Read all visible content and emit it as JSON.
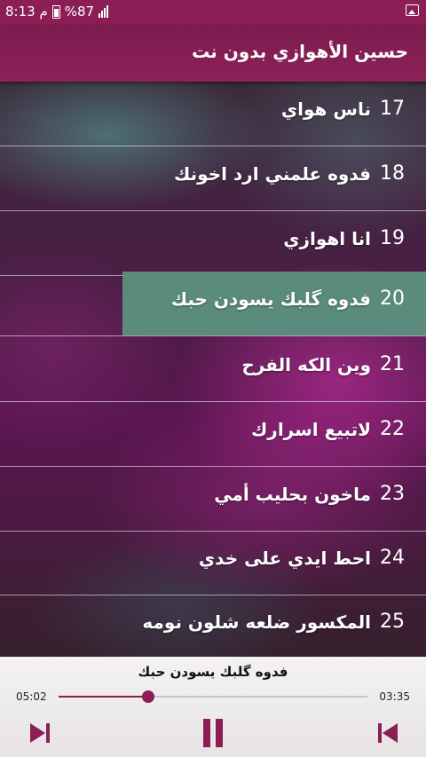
{
  "status_bar": {
    "time": "8:13 م",
    "battery": "%87",
    "icons": [
      "battery-icon",
      "signal-icon",
      "image-notification-icon"
    ]
  },
  "header": {
    "title": "حسين الأهوازي بدون نت"
  },
  "tracks": [
    {
      "number": "17",
      "title": "ناس هواي"
    },
    {
      "number": "18",
      "title": "فدوه علمني ارد اخونك"
    },
    {
      "number": "19",
      "title": "انا اهوازي"
    },
    {
      "number": "20",
      "title": "فدوه گلبك يسودن حبك",
      "active": true
    },
    {
      "number": "21",
      "title": "وين الكه الفرح"
    },
    {
      "number": "22",
      "title": "لاتبيع اسرارك"
    },
    {
      "number": "23",
      "title": "ماخون بحليب أمي"
    },
    {
      "number": "24",
      "title": "احط ايدي على خدي"
    },
    {
      "number": "25",
      "title": "المكسور ضلعه شلون نومه"
    }
  ],
  "player": {
    "now_playing": "فدوه گلبك يسودن حبك",
    "elapsed": "05:02",
    "remaining": "03:35",
    "progress": 0.29,
    "controls": [
      "next-icon",
      "pause-icon",
      "previous-icon"
    ]
  },
  "colors": {
    "accent": "#8a1e55",
    "active_row": "#5b8b7c"
  }
}
